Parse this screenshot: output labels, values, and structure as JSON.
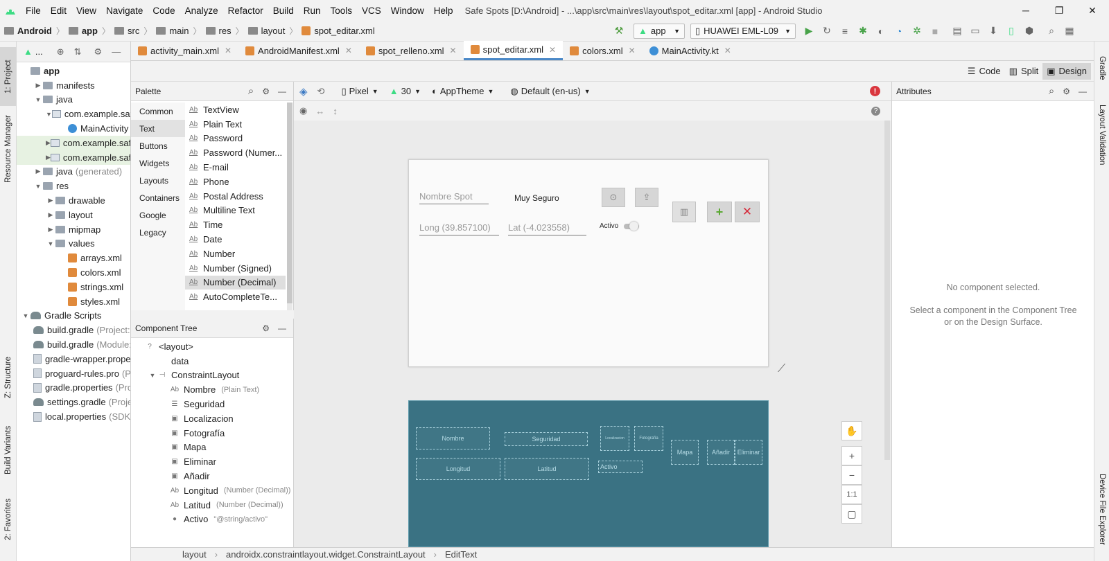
{
  "titlebar": {
    "menu": [
      "File",
      "Edit",
      "View",
      "Navigate",
      "Code",
      "Analyze",
      "Refactor",
      "Build",
      "Run",
      "Tools",
      "VCS",
      "Window",
      "Help"
    ],
    "title": "Safe Spots [D:\\Android] - ...\\app\\src\\main\\res\\layout\\spot_editar.xml [app] - Android Studio",
    "controls": [
      "─",
      "❐",
      "✕"
    ]
  },
  "breadcrumb": [
    "Android",
    "app",
    "src",
    "main",
    "res",
    "layout",
    "spot_editar.xml"
  ],
  "run_config": "app",
  "device": "HUAWEI EML-L09",
  "left_tabs": [
    "1: Project",
    "Resource Manager",
    "Z: Structure",
    "Build Variants",
    "2: Favorites"
  ],
  "right_tabs": [
    "Gradle",
    "Layout Validation",
    "Device File Explorer"
  ],
  "project_toolbar": {
    "view": "..."
  },
  "project_tree": [
    {
      "label": "app",
      "depth": 0,
      "icon": "folder",
      "bold": true
    },
    {
      "label": "manifests",
      "depth": 1,
      "icon": "folder",
      "arrow": "▶"
    },
    {
      "label": "java",
      "depth": 1,
      "icon": "folder",
      "arrow": "▼"
    },
    {
      "label": "com.example.safes",
      "depth": 2,
      "icon": "pkg",
      "arrow": "▼"
    },
    {
      "label": "MainActivity",
      "depth": 3,
      "icon": "kt"
    },
    {
      "label": "com.example.safes",
      "depth": 2,
      "icon": "pkg",
      "arrow": "▶",
      "sel": true
    },
    {
      "label": "com.example.safes",
      "depth": 2,
      "icon": "pkg",
      "arrow": "▶",
      "sel": true
    },
    {
      "label": "java",
      "hint": "(generated)",
      "depth": 1,
      "icon": "folder",
      "arrow": "▶"
    },
    {
      "label": "res",
      "depth": 1,
      "icon": "folder",
      "arrow": "▼"
    },
    {
      "label": "drawable",
      "depth": 2,
      "icon": "folder",
      "arrow": "▶"
    },
    {
      "label": "layout",
      "depth": 2,
      "icon": "folder",
      "arrow": "▶"
    },
    {
      "label": "mipmap",
      "depth": 2,
      "icon": "folder",
      "arrow": "▶"
    },
    {
      "label": "values",
      "depth": 2,
      "icon": "folder",
      "arrow": "▼"
    },
    {
      "label": "arrays.xml",
      "depth": 3,
      "icon": "xml"
    },
    {
      "label": "colors.xml",
      "depth": 3,
      "icon": "xml"
    },
    {
      "label": "strings.xml",
      "depth": 3,
      "icon": "xml"
    },
    {
      "label": "styles.xml",
      "depth": 3,
      "icon": "xml"
    },
    {
      "label": "Gradle Scripts",
      "depth": 0,
      "icon": "gradle",
      "arrow": "▼"
    },
    {
      "label": "build.gradle",
      "hint": "(Project: S",
      "depth": 1,
      "icon": "gradle"
    },
    {
      "label": "build.gradle",
      "hint": "(Module:",
      "depth": 1,
      "icon": "gradle"
    },
    {
      "label": "gradle-wrapper.prope",
      "depth": 1,
      "icon": "file"
    },
    {
      "label": "proguard-rules.pro",
      "hint": "(Pr",
      "depth": 1,
      "icon": "file"
    },
    {
      "label": "gradle.properties",
      "hint": "(Pro",
      "depth": 1,
      "icon": "file"
    },
    {
      "label": "settings.gradle",
      "hint": "(Projec",
      "depth": 1,
      "icon": "gradle"
    },
    {
      "label": "local.properties",
      "hint": "(SDK",
      "depth": 1,
      "icon": "file"
    }
  ],
  "editor_tabs": [
    {
      "label": "activity_main.xml",
      "icon": "xml"
    },
    {
      "label": "AndroidManifest.xml",
      "icon": "xml"
    },
    {
      "label": "spot_relleno.xml",
      "icon": "xml"
    },
    {
      "label": "spot_editar.xml",
      "icon": "xml",
      "active": true
    },
    {
      "label": "colors.xml",
      "icon": "xml"
    },
    {
      "label": "MainActivity.kt",
      "icon": "kt"
    }
  ],
  "modes": [
    "Code",
    "Split",
    "Design"
  ],
  "palette": {
    "title": "Palette",
    "categories": [
      "Common",
      "Text",
      "Buttons",
      "Widgets",
      "Layouts",
      "Containers",
      "Google",
      "Legacy"
    ],
    "selected_category": "Text",
    "items": [
      "TextView",
      "Plain Text",
      "Password",
      "Password (Numer...",
      "E-mail",
      "Phone",
      "Postal Address",
      "Multiline Text",
      "Time",
      "Date",
      "Number",
      "Number (Signed)",
      "Number (Decimal)",
      "AutoCompleteTe..."
    ],
    "selected_item": "Number (Decimal)"
  },
  "canvas_toolbar": {
    "device": "Pixel",
    "api": "30",
    "theme": "AppTheme",
    "locale": "Default (en-us)"
  },
  "design_preview": {
    "nombre_hint": "Nombre Spot",
    "seguridad": "Muy Seguro",
    "longitud_hint": "Long (39.857100)",
    "latitud_hint": "Lat (-4.023558)",
    "activo": "Activo"
  },
  "blueprint": {
    "nombre": "Nombre",
    "seguridad": "Seguridad",
    "localizacion": "Localizacion",
    "fotografia": "Fotografía",
    "mapa": "Mapa",
    "anadir": "Añadir",
    "eliminar": "Eliminar",
    "longitud": "Longitud",
    "latitud": "Latitud",
    "activo": "Activo"
  },
  "zoom_tools": [
    "✋",
    "+",
    "−",
    "1:1",
    "▢"
  ],
  "component_tree": {
    "title": "Component Tree",
    "rows": [
      {
        "label": "<layout>",
        "depth": 0,
        "icon": "?"
      },
      {
        "label": "data",
        "depth": 1,
        "icon": ""
      },
      {
        "label": "ConstraintLayout",
        "depth": 1,
        "icon": "⊣",
        "arrow": "▼"
      },
      {
        "label": "Nombre",
        "hint": "(Plain Text)",
        "depth": 2,
        "icon": "Ab"
      },
      {
        "label": "Seguridad",
        "depth": 2,
        "icon": "☰"
      },
      {
        "label": "Localizacion",
        "depth": 2,
        "icon": "▣"
      },
      {
        "label": "Fotografía",
        "depth": 2,
        "icon": "▣"
      },
      {
        "label": "Mapa",
        "depth": 2,
        "icon": "▣"
      },
      {
        "label": "Eliminar",
        "depth": 2,
        "icon": "▣"
      },
      {
        "label": "Añadir",
        "depth": 2,
        "icon": "▣"
      },
      {
        "label": "Longitud",
        "hint": "(Number (Decimal))",
        "depth": 2,
        "icon": "Ab"
      },
      {
        "label": "Latitud",
        "hint": "(Number (Decimal))",
        "depth": 2,
        "icon": "Ab"
      },
      {
        "label": "Activo",
        "hint": "\"@string/activo\"",
        "depth": 2,
        "icon": "●"
      }
    ]
  },
  "attributes": {
    "title": "Attributes",
    "empty_title": "No component selected.",
    "empty_body": "Select a component in the Component Tree or on the Design Surface."
  },
  "statusbar": [
    "layout",
    "androidx.constraintlayout.widget.ConstraintLayout",
    "EditText"
  ],
  "colors": {
    "accent": "#4a88c7",
    "blueprint": "#3a7283",
    "add": "#5aa832",
    "delete": "#d52c3c",
    "error": "#d9363e"
  }
}
